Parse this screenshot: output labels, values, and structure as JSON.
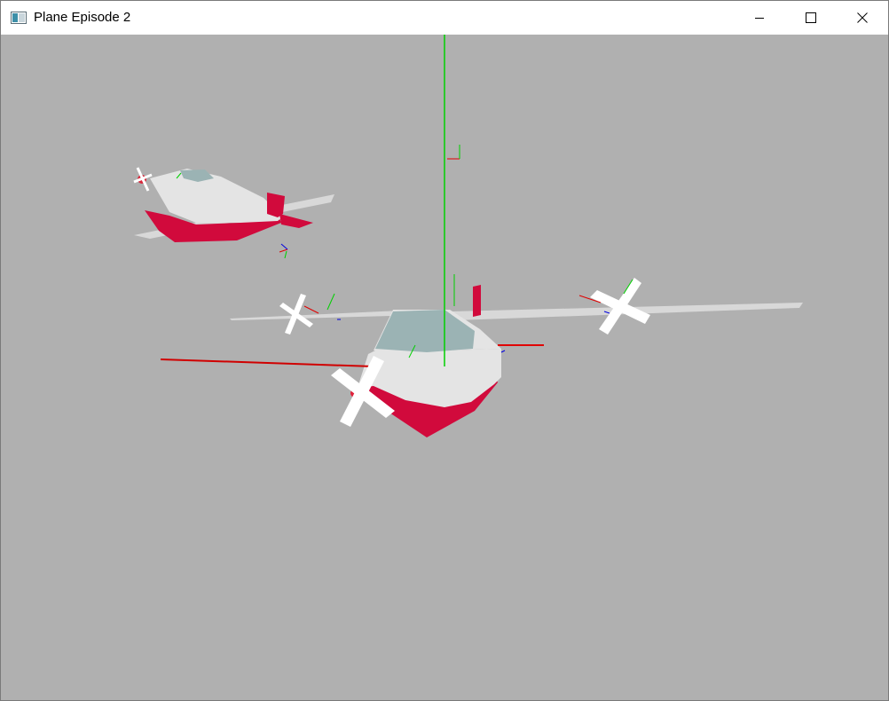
{
  "window": {
    "title": "Plane Episode 2",
    "controls": {
      "minimize_icon": "minimize-icon",
      "maximize_icon": "maximize-icon",
      "close_icon": "close-icon"
    }
  },
  "scene": {
    "background_color": "#b0b0b0",
    "colors": {
      "fuselage_white": "#e4e4e4",
      "fuselage_red": "#d10a3c",
      "cockpit": "#9bb3b4",
      "wing": "#d8d8d8",
      "propeller": "#ffffff",
      "axis_x": "#e00000",
      "axis_y": "#00d000",
      "axis_z": "#0000e0"
    }
  }
}
